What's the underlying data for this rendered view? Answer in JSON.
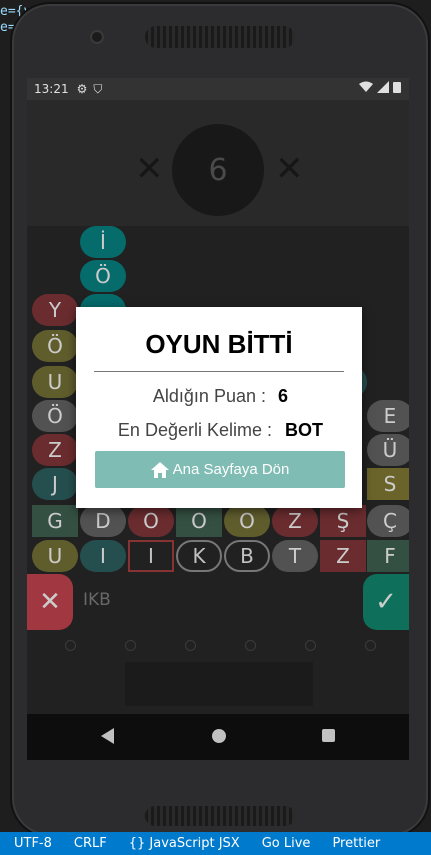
{
  "status": {
    "time": "13:21"
  },
  "header": {
    "score": "6",
    "close_left": "✕",
    "close_right": "✕"
  },
  "board": {
    "rows": [
      [
        {
          "c": "İ",
          "cls": "c-tealb"
        }
      ],
      [
        {
          "c": "Ö",
          "cls": "c-tealb"
        }
      ],
      [
        {
          "c": "Y",
          "cls": "c-red"
        },
        {
          "c": "",
          "cls": "c-gray"
        }
      ],
      [
        {
          "c": "Ö",
          "cls": "c-olive"
        }
      ],
      [
        {
          "c": "U",
          "cls": "c-olive"
        }
      ],
      [
        {
          "c": "Ö",
          "cls": "c-gray"
        },
        {
          "c": "E",
          "cls": "c-gray"
        }
      ],
      [
        {
          "c": "Z",
          "cls": "c-red"
        },
        {
          "c": "Ü",
          "cls": "c-gray"
        }
      ],
      [
        {
          "c": "J",
          "cls": "c-teal"
        },
        {
          "c": "S",
          "cls": "c-yellow"
        }
      ],
      [
        {
          "c": "G",
          "cls": "c-green"
        },
        {
          "c": "D",
          "cls": "c-gray"
        },
        {
          "c": "O",
          "cls": "c-red"
        },
        {
          "c": "O",
          "cls": "c-green"
        },
        {
          "c": "O",
          "cls": "c-olive"
        },
        {
          "c": "Z",
          "cls": "c-red"
        },
        {
          "c": "Ş",
          "cls": "c-red"
        },
        {
          "c": "Ç",
          "cls": "c-gray"
        }
      ],
      [
        {
          "c": "U",
          "cls": "c-olive"
        },
        {
          "c": "I",
          "cls": "c-teal"
        },
        {
          "c": "I",
          "cls": "sel"
        },
        {
          "c": "K",
          "cls": "outline"
        },
        {
          "c": "B",
          "cls": "outline"
        },
        {
          "c": "T",
          "cls": "c-gray"
        },
        {
          "c": "Z",
          "cls": "c-red"
        },
        {
          "c": "F",
          "cls": "c-green"
        }
      ]
    ]
  },
  "input": {
    "word": "IKB",
    "cancel_icon": "✕",
    "ok_icon": "✓"
  },
  "modal": {
    "title": "OYUN BİTTİ",
    "score_label": "Aldığın Puan :",
    "score_value": "6",
    "best_label": "En Değerli Kelime :",
    "best_value": "BOT",
    "home_button": "Ana Sayfaya Dön"
  },
  "editor": {
    "taskbar": [
      "UTF-8",
      "CRLF",
      "{} JavaScript JSX",
      "Go Live",
      "Prettier"
    ],
    "fragments": [
      "e={v",
      "e="
    ]
  }
}
